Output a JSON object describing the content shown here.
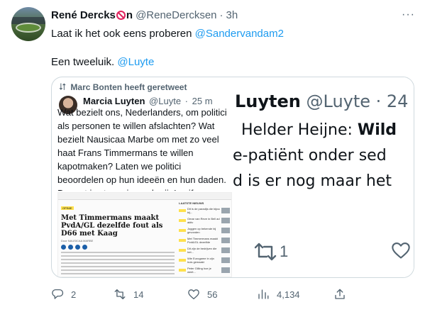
{
  "tweet": {
    "author_name": "René Dercks",
    "author_name_suffix": "n",
    "handle": "@ReneDercksen",
    "separator": "·",
    "time": "3h",
    "more_icon": "more-icon",
    "line1_text": "Laat ik het ook eens proberen ",
    "line1_mention": "@Sandervandam2",
    "line2_text": "Een tweeluik. ",
    "line2_mention": "@Luyte"
  },
  "quote": {
    "retweet_label": "Marc Bonten heeft geretweet",
    "author_name": "Marcia Luyten",
    "handle": "@Luyte",
    "separator": "·",
    "time": "25 m",
    "text": "Wat bezielt ons, Nederlanders, om politici\nals personen te willen afslachten? Wat\nbezielt Nausicaa Marbe om met zo veel\nhaat Frans Timmermans te willen\nkapotmaken? Laten we politici\nbeoordelen op hun ideeën en hun daden.\nDe rest is stemmingmakerij. Is gif",
    "article": {
      "tag": "OPINIE",
      "title": "Met Timmermans maakt PvdA/GL dezelfde fout als D66 met Kaag",
      "meta": "Door NAUSICAA MARBE",
      "sidebar_title": "LAATSTE NIEUWS",
      "sidebar_items": [
        "Dit is de paradijs die bijna bij...",
        "Omar van Reve in Bell ad aktiv",
        "Joggen op bekende bij gevonden",
        "Met Timmermans maakt PvdA/GL dezelfde",
        "Dit zijn de bedrijven die het...",
        "Wie Eurogame in zijn huis gemaakt",
        "Peter Gilling hoe je weet..."
      ]
    },
    "zoom": {
      "line1_name": "Luyten",
      "line1_rest": " @Luyte · 24",
      "line2_bold": "Helder Heijne: ",
      "line2_bold2": "Wild",
      "line3": "e-patiënt onder sed",
      "line4": "d is er nog maar het",
      "retweet_count": "1",
      "retweet_icon": "retweet-icon",
      "heart_icon": "heart-icon"
    }
  },
  "actions": {
    "reply_count": "2",
    "retweet_count": "14",
    "like_count": "56",
    "views_count": "4,134",
    "reply_icon": "reply-icon",
    "retweet_icon": "retweet-icon",
    "like_icon": "heart-icon",
    "views_icon": "views-icon",
    "share_icon": "share-icon"
  },
  "colors": {
    "link": "#1d9bf0",
    "secondary_text": "#536471",
    "border": "#cfd9de"
  }
}
